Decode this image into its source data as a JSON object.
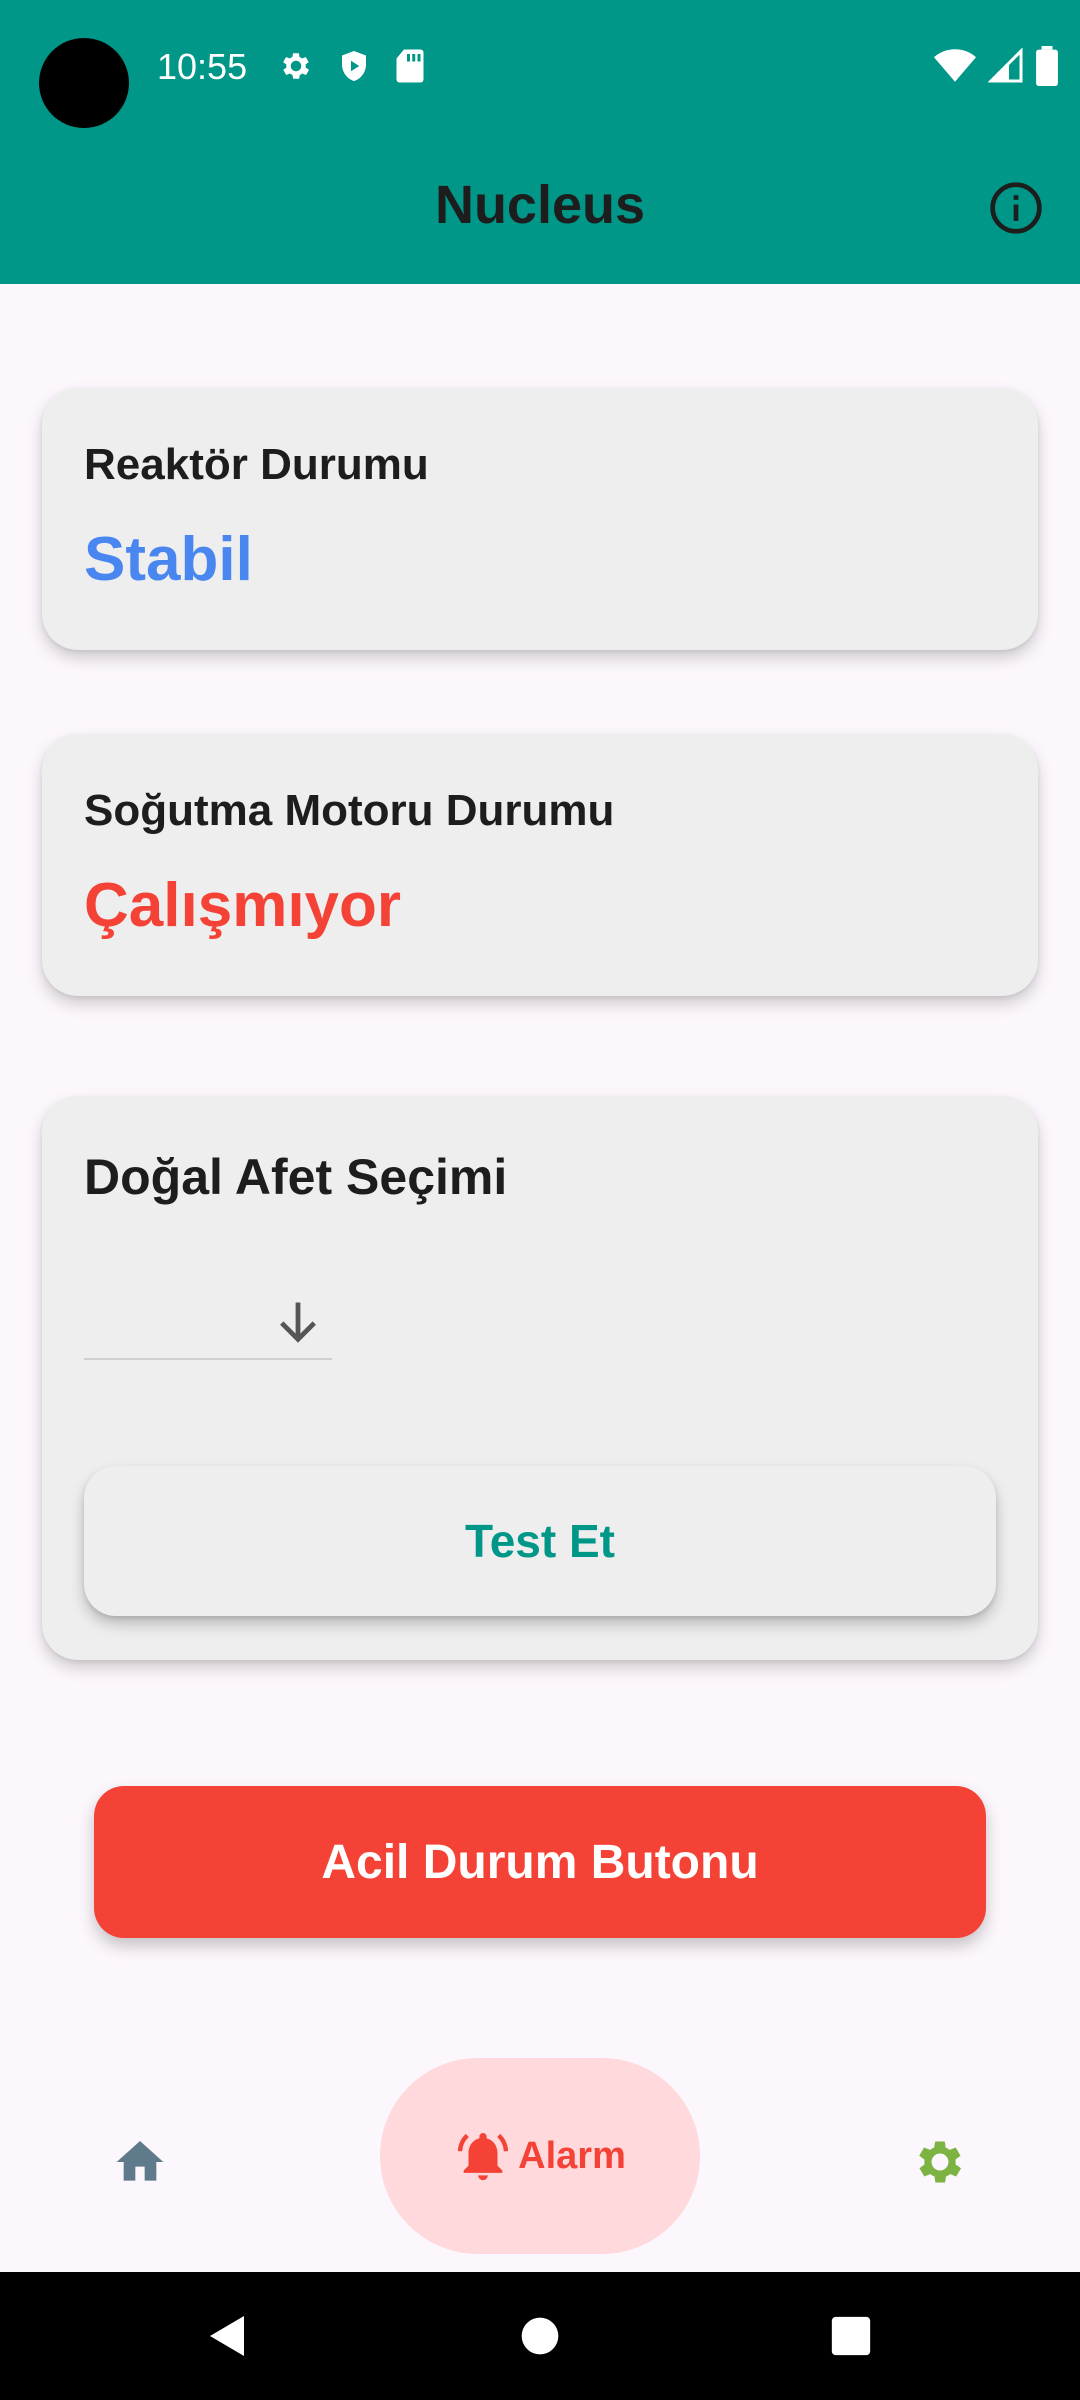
{
  "status_bar": {
    "time": "10:55",
    "left_icons": [
      "settings-icon",
      "shield-play-icon",
      "sd-card-icon"
    ],
    "right_icons": [
      "wifi-icon",
      "signal-icon",
      "battery-icon"
    ]
  },
  "app_bar": {
    "title": "Nucleus",
    "action_icon": "info-icon"
  },
  "reactor_card": {
    "title": "Reaktör Durumu",
    "value": "Stabil",
    "value_color": "#4A86F0"
  },
  "cooling_card": {
    "title": "Soğutma Motoru Durumu",
    "value": "Çalışmıyor",
    "value_color": "#F44336"
  },
  "disaster_card": {
    "title": "Doğal Afet Seçimi",
    "dropdown_value": "",
    "test_button_label": "Test Et"
  },
  "emergency_button_label": "Acil Durum Butonu",
  "bottom_nav": {
    "items": [
      {
        "icon": "home-icon",
        "label": ""
      },
      {
        "icon": "alarm-icon",
        "label": "Alarm",
        "selected": true
      },
      {
        "icon": "gear-icon",
        "label": ""
      }
    ]
  },
  "colors": {
    "primary": "#009688",
    "danger": "#F44336",
    "accent_blue": "#4A86F0",
    "settings_green": "#7CB342"
  }
}
